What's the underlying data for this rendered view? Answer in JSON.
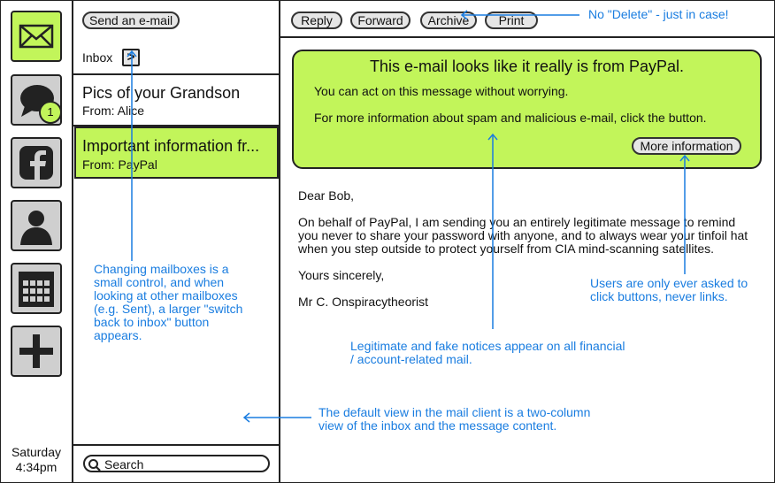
{
  "rail": {
    "icons": [
      "mail-icon",
      "chat-icon",
      "facebook-icon",
      "contacts-icon",
      "calendar-icon",
      "add-icon"
    ],
    "chat_badge": "1",
    "clock_day": "Saturday",
    "clock_time": "4:34pm"
  },
  "mailbox": {
    "compose_label": "Send an e-mail",
    "current": "Inbox",
    "switch_glyph": ">",
    "search_placeholder": "Search"
  },
  "messages": [
    {
      "subject": "Pics of your Grandson",
      "from": "From: Alice",
      "selected": false
    },
    {
      "subject": "Important information fr...",
      "from": "From: PayPal",
      "selected": true
    }
  ],
  "toolbar": {
    "reply": "Reply",
    "forward": "Forward",
    "archive": "Archive",
    "print": "Print"
  },
  "notice": {
    "title": "This e-mail looks like it really is from PayPal.",
    "line1": "You can act on this message without worrying.",
    "line2": "For more information about spam and malicious e-mail, click the button.",
    "button": "More information"
  },
  "email_body": {
    "greeting": "Dear Bob,",
    "paragraph": [
      "On behalf of PayPal, I am sending you an entirely legitimate message to remind",
      "you never to share your password with anyone, and to always wear your tinfoil hat",
      "when you step outside to protect yourself from CIA mind-scanning satellites."
    ],
    "closing": "Yours sincerely,",
    "signature": "Mr C. Onspiracytheorist"
  },
  "annotations": {
    "no_delete": "No \"Delete\" - just in case!",
    "mailboxes": [
      "Changing mailboxes is a",
      "small control, and when",
      "looking at other mailboxes",
      "(e.g. Sent), a larger \"switch",
      "back to inbox\" button",
      "appears."
    ],
    "notices": [
      "Legitimate and fake notices appear on all financial",
      "/ account-related mail."
    ],
    "buttons": [
      "Users are only ever asked to",
      "click buttons, never links."
    ],
    "default_view": [
      "The default view in the mail client is a two-column",
      "view of the inbox and the message content."
    ]
  },
  "colors": {
    "accent_green": "#c2f55a",
    "annotation_blue": "#1a7de0",
    "button_gray": "#e6e6e6"
  }
}
